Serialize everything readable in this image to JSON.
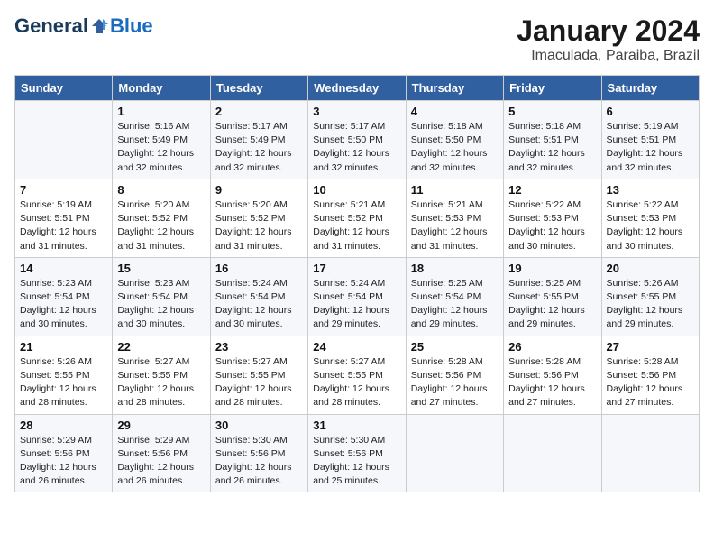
{
  "header": {
    "logo_general": "General",
    "logo_blue": "Blue",
    "month": "January 2024",
    "location": "Imaculada, Paraiba, Brazil"
  },
  "days_of_week": [
    "Sunday",
    "Monday",
    "Tuesday",
    "Wednesday",
    "Thursday",
    "Friday",
    "Saturday"
  ],
  "weeks": [
    [
      {
        "day": "",
        "info": ""
      },
      {
        "day": "1",
        "info": "Sunrise: 5:16 AM\nSunset: 5:49 PM\nDaylight: 12 hours\nand 32 minutes."
      },
      {
        "day": "2",
        "info": "Sunrise: 5:17 AM\nSunset: 5:49 PM\nDaylight: 12 hours\nand 32 minutes."
      },
      {
        "day": "3",
        "info": "Sunrise: 5:17 AM\nSunset: 5:50 PM\nDaylight: 12 hours\nand 32 minutes."
      },
      {
        "day": "4",
        "info": "Sunrise: 5:18 AM\nSunset: 5:50 PM\nDaylight: 12 hours\nand 32 minutes."
      },
      {
        "day": "5",
        "info": "Sunrise: 5:18 AM\nSunset: 5:51 PM\nDaylight: 12 hours\nand 32 minutes."
      },
      {
        "day": "6",
        "info": "Sunrise: 5:19 AM\nSunset: 5:51 PM\nDaylight: 12 hours\nand 32 minutes."
      }
    ],
    [
      {
        "day": "7",
        "info": "Sunrise: 5:19 AM\nSunset: 5:51 PM\nDaylight: 12 hours\nand 31 minutes."
      },
      {
        "day": "8",
        "info": "Sunrise: 5:20 AM\nSunset: 5:52 PM\nDaylight: 12 hours\nand 31 minutes."
      },
      {
        "day": "9",
        "info": "Sunrise: 5:20 AM\nSunset: 5:52 PM\nDaylight: 12 hours\nand 31 minutes."
      },
      {
        "day": "10",
        "info": "Sunrise: 5:21 AM\nSunset: 5:52 PM\nDaylight: 12 hours\nand 31 minutes."
      },
      {
        "day": "11",
        "info": "Sunrise: 5:21 AM\nSunset: 5:53 PM\nDaylight: 12 hours\nand 31 minutes."
      },
      {
        "day": "12",
        "info": "Sunrise: 5:22 AM\nSunset: 5:53 PM\nDaylight: 12 hours\nand 30 minutes."
      },
      {
        "day": "13",
        "info": "Sunrise: 5:22 AM\nSunset: 5:53 PM\nDaylight: 12 hours\nand 30 minutes."
      }
    ],
    [
      {
        "day": "14",
        "info": "Sunrise: 5:23 AM\nSunset: 5:54 PM\nDaylight: 12 hours\nand 30 minutes."
      },
      {
        "day": "15",
        "info": "Sunrise: 5:23 AM\nSunset: 5:54 PM\nDaylight: 12 hours\nand 30 minutes."
      },
      {
        "day": "16",
        "info": "Sunrise: 5:24 AM\nSunset: 5:54 PM\nDaylight: 12 hours\nand 30 minutes."
      },
      {
        "day": "17",
        "info": "Sunrise: 5:24 AM\nSunset: 5:54 PM\nDaylight: 12 hours\nand 29 minutes."
      },
      {
        "day": "18",
        "info": "Sunrise: 5:25 AM\nSunset: 5:54 PM\nDaylight: 12 hours\nand 29 minutes."
      },
      {
        "day": "19",
        "info": "Sunrise: 5:25 AM\nSunset: 5:55 PM\nDaylight: 12 hours\nand 29 minutes."
      },
      {
        "day": "20",
        "info": "Sunrise: 5:26 AM\nSunset: 5:55 PM\nDaylight: 12 hours\nand 29 minutes."
      }
    ],
    [
      {
        "day": "21",
        "info": "Sunrise: 5:26 AM\nSunset: 5:55 PM\nDaylight: 12 hours\nand 28 minutes."
      },
      {
        "day": "22",
        "info": "Sunrise: 5:27 AM\nSunset: 5:55 PM\nDaylight: 12 hours\nand 28 minutes."
      },
      {
        "day": "23",
        "info": "Sunrise: 5:27 AM\nSunset: 5:55 PM\nDaylight: 12 hours\nand 28 minutes."
      },
      {
        "day": "24",
        "info": "Sunrise: 5:27 AM\nSunset: 5:55 PM\nDaylight: 12 hours\nand 28 minutes."
      },
      {
        "day": "25",
        "info": "Sunrise: 5:28 AM\nSunset: 5:56 PM\nDaylight: 12 hours\nand 27 minutes."
      },
      {
        "day": "26",
        "info": "Sunrise: 5:28 AM\nSunset: 5:56 PM\nDaylight: 12 hours\nand 27 minutes."
      },
      {
        "day": "27",
        "info": "Sunrise: 5:28 AM\nSunset: 5:56 PM\nDaylight: 12 hours\nand 27 minutes."
      }
    ],
    [
      {
        "day": "28",
        "info": "Sunrise: 5:29 AM\nSunset: 5:56 PM\nDaylight: 12 hours\nand 26 minutes."
      },
      {
        "day": "29",
        "info": "Sunrise: 5:29 AM\nSunset: 5:56 PM\nDaylight: 12 hours\nand 26 minutes."
      },
      {
        "day": "30",
        "info": "Sunrise: 5:30 AM\nSunset: 5:56 PM\nDaylight: 12 hours\nand 26 minutes."
      },
      {
        "day": "31",
        "info": "Sunrise: 5:30 AM\nSunset: 5:56 PM\nDaylight: 12 hours\nand 25 minutes."
      },
      {
        "day": "",
        "info": ""
      },
      {
        "day": "",
        "info": ""
      },
      {
        "day": "",
        "info": ""
      }
    ]
  ]
}
